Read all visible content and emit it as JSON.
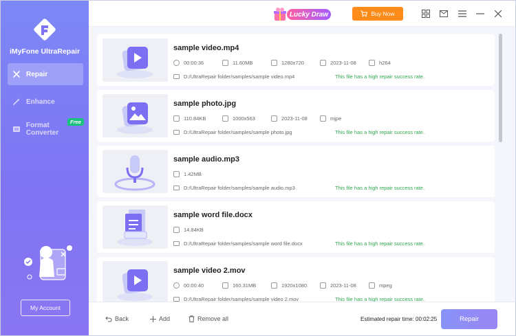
{
  "app": {
    "name": "iMyFone UltraRepair",
    "colors": {
      "accent": "#7f74f3",
      "success": "#2fa84f",
      "buy": "#ff8c1a",
      "free_badge": "#19c37d"
    }
  },
  "sidebar": {
    "items": [
      {
        "label": "Repair",
        "icon": "repair-tools-icon",
        "active": true
      },
      {
        "label": "Enhance",
        "icon": "magic-wand-icon",
        "active": false
      },
      {
        "label": "Format Converter",
        "icon": "format-converter-icon",
        "active": false,
        "badge": "Free"
      }
    ],
    "account_label": "My Account"
  },
  "topbar": {
    "lucky_draw": "Lucky Draw",
    "buy_now": "Buy Now",
    "icons": [
      "grid-icon",
      "mail-icon",
      "menu-icon",
      "minimize-icon",
      "close-icon"
    ]
  },
  "files": [
    {
      "name": "sample video.mp4",
      "meta": [
        "00:00:36",
        "11.60MB",
        "1280x720",
        "2023-11-08",
        "h264"
      ],
      "meta_icons": [
        "clock-icon",
        "file-size-icon",
        "resolution-icon",
        "date-icon",
        "codec-icon"
      ],
      "path": "D:/UltraRepair folder/samples/sample video.mp4",
      "status": "This file has a high repair success rate.",
      "thumb": "video"
    },
    {
      "name": "sample photo.jpg",
      "meta": [
        "110.84KB",
        "1000x563",
        "2023-11-08",
        "mjpe"
      ],
      "meta_icons": [
        "file-size-icon",
        "resolution-icon",
        "date-icon",
        "codec-icon"
      ],
      "path": "D:/UltraRepair folder/samples/sample photo.jpg",
      "status": "This file has a high repair success rate.",
      "thumb": "photo"
    },
    {
      "name": "sample audio.mp3",
      "meta": [
        "1.42MB"
      ],
      "meta_icons": [
        "file-size-icon"
      ],
      "path": "D:/UltraRepair folder/samples/sample audio.mp3",
      "status": "This file has a high repair success rate.",
      "thumb": "audio"
    },
    {
      "name": "sample word file.docx",
      "meta": [
        "14.84KB"
      ],
      "meta_icons": [
        "file-size-icon"
      ],
      "path": "D:/UltraRepair folder/samples/sample word file.docx",
      "status": "This file has a high repair success rate.",
      "thumb": "document"
    },
    {
      "name": "sample video 2.mov",
      "meta": [
        "00:00:40",
        "160.31MB",
        "1920x1080",
        "2023-11-08",
        "mpeg"
      ],
      "meta_icons": [
        "clock-icon",
        "file-size-icon",
        "resolution-icon",
        "date-icon",
        "codec-icon"
      ],
      "path": "D:/UltraRepair folder/samples/sample video 2.mov",
      "status": "This file has a high repair success rate.",
      "thumb": "video"
    }
  ],
  "bottombar": {
    "back": "Back",
    "add": "Add",
    "remove_all": "Remove all",
    "estimated_label": "Estimated repair time:",
    "estimated_value": "00:02:25",
    "repair": "Repair"
  }
}
